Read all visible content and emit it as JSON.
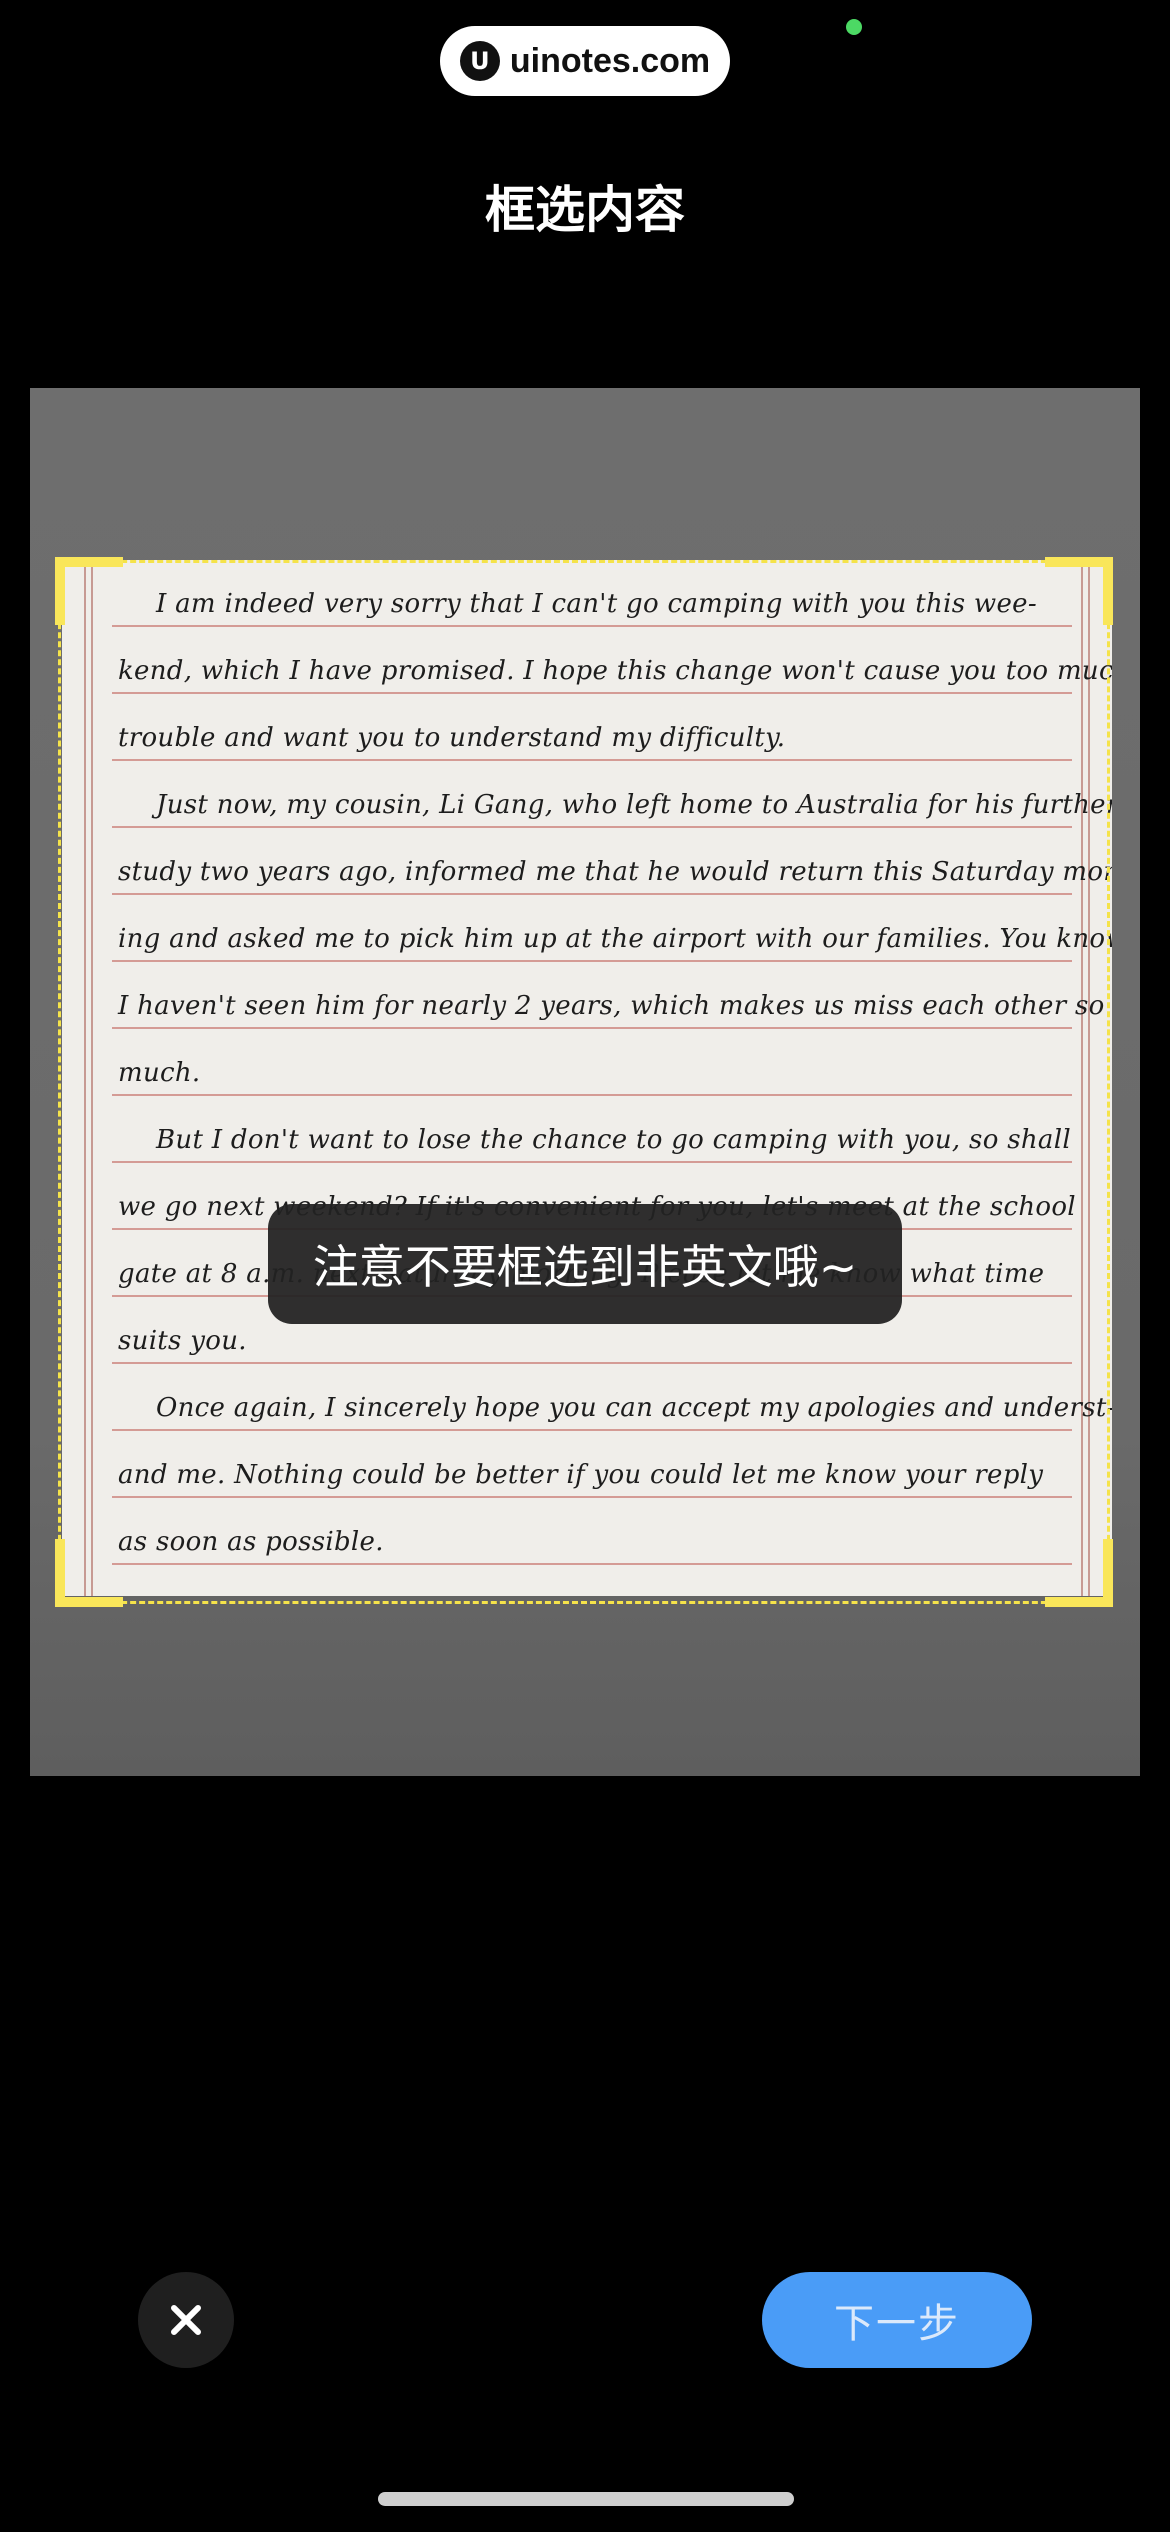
{
  "watermark": {
    "logo": "U",
    "text": "uinotes.com"
  },
  "header": {
    "title": "框选内容"
  },
  "document": {
    "lines": [
      "I am indeed very sorry that I can't go camping with you this wee-",
      "kend, which I have promised. I hope this change won't cause you too much",
      "trouble and want you to understand my difficulty.",
      "Just now, my cousin, Li Gang, who left home to Australia for his further",
      "study two years ago, informed me that he would return this Saturday morn-",
      "ing and asked me to pick him up at the airport with our families. You know,",
      "I haven't seen him for nearly 2 years, which makes us miss each other so",
      "much.",
      "But I don't want to lose the chance to go camping with you, so shall",
      "we go next weekend? If it's convenient for you, let's meet at the school",
      "gate at 8 a.m. next Saturday morning. Please let me know what time",
      "suits you.",
      "Once again, I sincerely hope you can accept my apologies and underst-",
      "and me. Nothing could be better if you could let me know your reply",
      "as soon as possible."
    ]
  },
  "toast": {
    "message": "注意不要框选到非英文哦~"
  },
  "actions": {
    "close_icon": "close-icon",
    "next_label": "下一步"
  },
  "colors": {
    "accent": "#4a9cf7",
    "crop_frame": "#f5e34a"
  }
}
